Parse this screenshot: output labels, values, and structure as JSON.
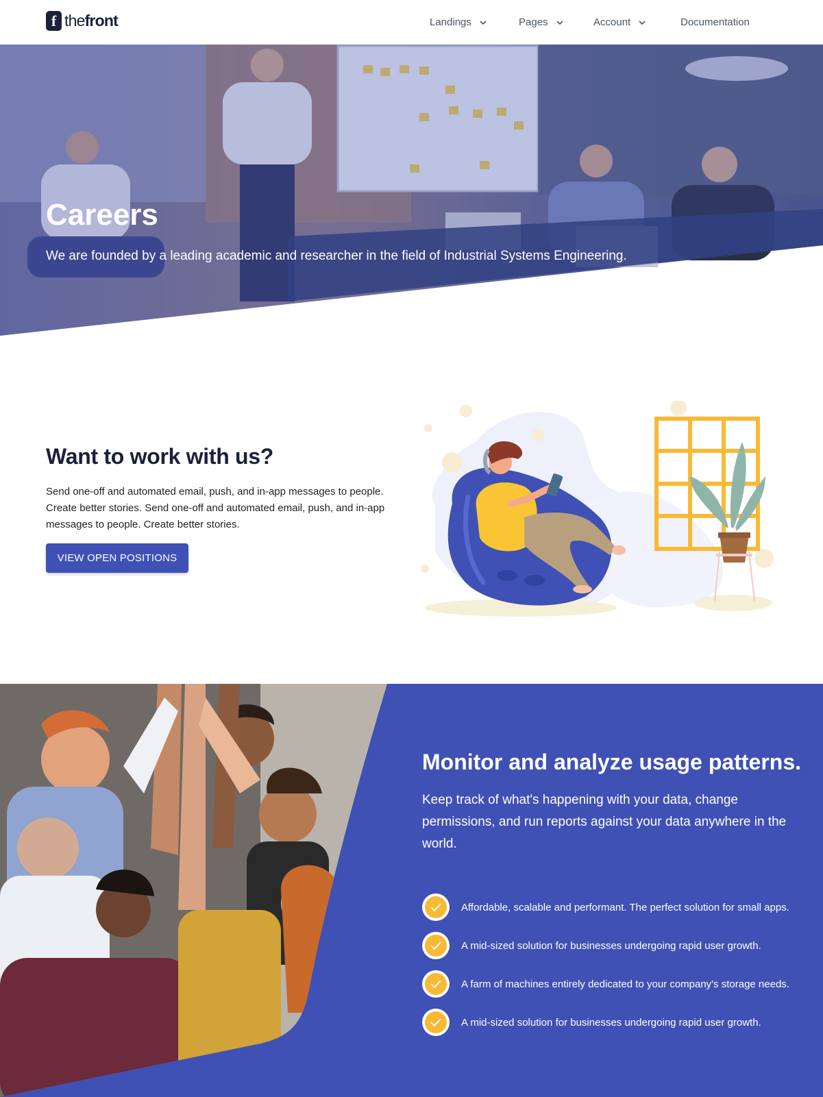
{
  "header": {
    "logo_mark": "f",
    "logo_text_light": "the",
    "logo_text_bold": "front",
    "nav": [
      {
        "label": "Landings",
        "has_dropdown": true
      },
      {
        "label": "Pages",
        "has_dropdown": true
      },
      {
        "label": "Account",
        "has_dropdown": true
      },
      {
        "label": "Documentation",
        "has_dropdown": false
      }
    ]
  },
  "hero": {
    "title": "Careers",
    "subtitle": "We are founded by a leading academic and researcher in the field of Industrial Systems Engineering."
  },
  "work": {
    "title": "Want to work with us?",
    "text": "Send one-off and automated email, push, and in-app messages to people. Create better stories. Send one-off and automated email, push, and in-app messages to people. Create better stories.",
    "button_label": "VIEW OPEN POSITIONS"
  },
  "monitor": {
    "title": "Monitor and analyze usage patterns.",
    "subtitle": "Keep track of what's happening with your data, change permissions, and run reports against your data anywhere in the world.",
    "features": [
      "Affordable, scalable and performant. The perfect solution for small apps.",
      "A mid-sized solution for businesses undergoing rapid user growth.",
      "A farm of machines entirely dedicated to your company's storage needs.",
      "A mid-sized solution for businesses undergoing rapid user growth."
    ]
  },
  "colors": {
    "primary": "#3f51b5",
    "accent": "#f9b934",
    "dark": "#1a1f3a"
  },
  "icons": [
    "chevron-down-icon",
    "check-icon",
    "logo-icon"
  ]
}
